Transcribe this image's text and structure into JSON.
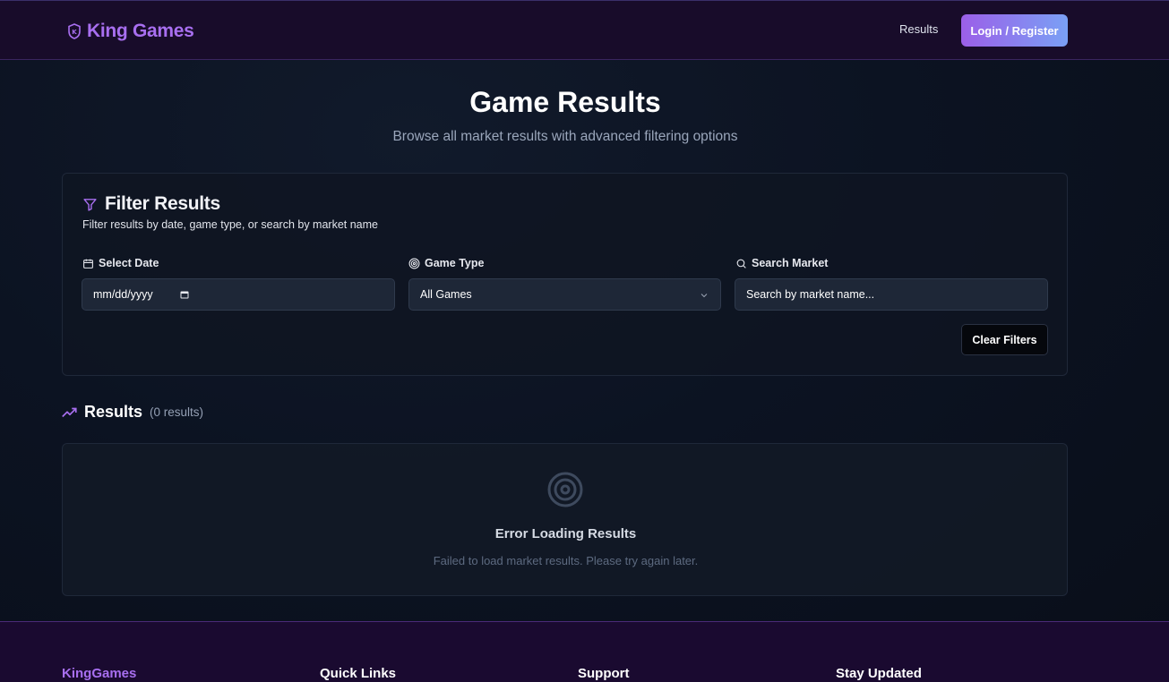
{
  "header": {
    "brand": "King Games",
    "nav_results": "Results",
    "login_label": "Login / Register"
  },
  "page": {
    "title": "Game Results",
    "subtitle": "Browse all market results with advanced filtering options"
  },
  "filter": {
    "title": "Filter Results",
    "description": "Filter results by date, game type, or search by market name",
    "date_label": "Select Date",
    "date_placeholder": "mm/dd/yyyy",
    "game_type_label": "Game Type",
    "game_type_value": "All Games",
    "search_label": "Search Market",
    "search_placeholder": "Search by market name...",
    "clear_label": "Clear Filters"
  },
  "results": {
    "title": "Results",
    "count": "(0 results)",
    "error_title": "Error Loading Results",
    "error_message": "Failed to load market results. Please try again later."
  },
  "footer": {
    "col1": "KingGames",
    "col2": "Quick Links",
    "col3": "Support",
    "col4": "Stay Updated"
  },
  "colors": {
    "accent": "#a86ff0",
    "header_bg": "#180c2a",
    "button_gradient_start": "#9b5fe8",
    "button_gradient_end": "#7aa0f5"
  }
}
